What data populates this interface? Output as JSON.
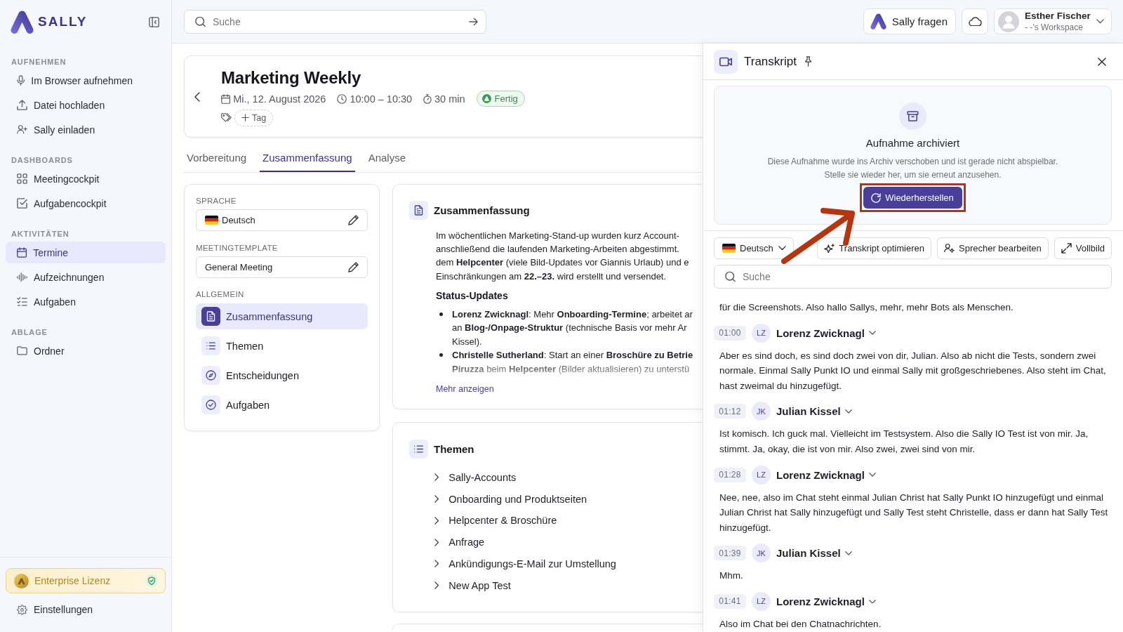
{
  "sidebar": {
    "brand": "SALLY",
    "sections": [
      {
        "title": "AUFNEHMEN",
        "items": [
          {
            "label": "Im Browser aufnehmen",
            "selected": false
          },
          {
            "label": "Datei hochladen",
            "selected": false
          },
          {
            "label": "Sally einladen",
            "selected": false
          }
        ]
      },
      {
        "title": "DASHBOARDS",
        "items": [
          {
            "label": "Meetingcockpit",
            "selected": false
          },
          {
            "label": "Aufgabencockpit",
            "selected": false
          }
        ]
      },
      {
        "title": "AKTIVITÄTEN",
        "items": [
          {
            "label": "Termine",
            "selected": true
          },
          {
            "label": "Aufzeichnungen",
            "selected": false
          },
          {
            "label": "Aufgaben",
            "selected": false
          }
        ]
      },
      {
        "title": "ABLAGE",
        "items": [
          {
            "label": "Ordner",
            "selected": false
          }
        ]
      }
    ],
    "license": "Enterprise Lizenz",
    "settings": "Einstellungen"
  },
  "header": {
    "search": {
      "placeholder": "Suche"
    },
    "ask_button": "Sally fragen",
    "user": {
      "name": "Esther Fischer",
      "workspace": "- -’s Workspace"
    }
  },
  "meeting": {
    "title": "Marketing Weekly",
    "date": "Mi., 12. August 2026",
    "time": "10:00 – 10:30",
    "duration": "30 min",
    "status": "Fertig",
    "tag_button": "Tag"
  },
  "tabs": [
    {
      "label": "Vorbereitung",
      "selected": false
    },
    {
      "label": "Zusammenfassung",
      "selected": true
    },
    {
      "label": "Analyse",
      "selected": false
    }
  ],
  "settings_panel": {
    "language_label": "SPRACHE",
    "language": "Deutsch",
    "template_label": "MEETINGTEMPLATE",
    "template": "General Meeting",
    "nav_label": "ALLGEMEIN",
    "nav": [
      {
        "label": "Zusammenfassung",
        "selected": true
      },
      {
        "label": "Themen",
        "selected": false
      },
      {
        "label": "Entscheidungen",
        "selected": false
      },
      {
        "label": "Aufgaben",
        "selected": false
      }
    ]
  },
  "summary": {
    "title": "Zusammenfassung",
    "paragraph_lines": [
      "Im wöchentlichen Marketing-Stand-up wurden kurz Account-",
      "anschließend die laufenden Marketing-Arbeiten abgestimmt.",
      "dem **Helpcenter** (viele Bild-Updates vor Giannis Urlaub) und e",
      "Einschränkungen am **22.–23.** wird erstellt und versendet."
    ],
    "status_heading": "Status-Updates",
    "bullets": [
      {
        "lines": [
          "**Lorenz Zwicknagl**: Mehr **Onboarding-Termine**; arbeitet ar",
          "an **Blog-/Onpage-Struktur** (technische Basis vor mehr Ar",
          "Kissel)."
        ]
      },
      {
        "lines": [
          "**Christelle Sutherland**: Start an einer **Broschüre zu Betrie**",
          "**Piruzza** beim **Helpcenter** (Bilder aktualisieren) zu unterstü"
        ]
      }
    ],
    "more_link": "Mehr anzeigen"
  },
  "topics": {
    "title": "Themen",
    "items": [
      {
        "label": "Sally-Accounts",
        "expanded": false
      },
      {
        "label": "Onboarding und Produktseiten",
        "expanded": false
      },
      {
        "label": "Helpcenter & Broschüre",
        "expanded": false
      },
      {
        "label": "Anfrage",
        "expanded": false
      },
      {
        "label": "Ankündigungs-E-Mail zur Umstellung",
        "expanded": false
      },
      {
        "label": "New App Test",
        "expanded": false
      }
    ]
  },
  "transcript": {
    "title": "Transkript",
    "archived": {
      "title": "Aufnahme archiviert",
      "description_lines": [
        "Diese Aufnahme wurde ins Archiv verschoben und ist gerade nicht abspielbar.",
        "Stelle sie wieder her, um sie erneut anzusehen."
      ],
      "restore_button": "Wiederherstellen"
    },
    "language": "Deutsch",
    "tools": [
      "Transkript optimieren",
      "Sprecher bearbeiten",
      "Vollbild"
    ],
    "search": {
      "placeholder": "Suche"
    },
    "continued_text": "für die Screenshots. Also hallo Sallys, mehr, mehr Bots als Menschen.",
    "entries": [
      {
        "time": "01:00",
        "initials": "LZ",
        "speaker": "Lorenz Zwicknagl",
        "text": "Aber es sind doch, es sind doch zwei von dir, Julian. Also ab nicht die Tests, sondern zwei normale. Einmal Sally Punkt IO und einmal Sally mit großgeschriebenes. Also steht im Chat, hast zweimal du hinzugefügt."
      },
      {
        "time": "01:12",
        "initials": "JK",
        "speaker": "Julian Kissel",
        "text": "Ist komisch. Ich guck mal. Vielleicht im Testsystem. Also die Sally IO Test ist von mir. Ja, stimmt. Ja, okay, die ist von mir. Also zwei, zwei sind von mir."
      },
      {
        "time": "01:28",
        "initials": "LZ",
        "speaker": "Lorenz Zwicknagl",
        "text": "Nee, nee, also im Chat steht einmal Julian Christ hat Sally Punkt IO hinzugefügt und einmal Julian Christ hat Sally hinzugefügt und Sally Test steht Christelle, dass er dann hat Sally Test hinzugefügt."
      },
      {
        "time": "01:39",
        "initials": "JK",
        "speaker": "Julian Kissel",
        "text": "Mhm."
      },
      {
        "time": "01:41",
        "initials": "LZ",
        "speaker": "Lorenz Zwicknagl",
        "text": "Also im Chat bei den Chatnachrichten."
      }
    ]
  }
}
